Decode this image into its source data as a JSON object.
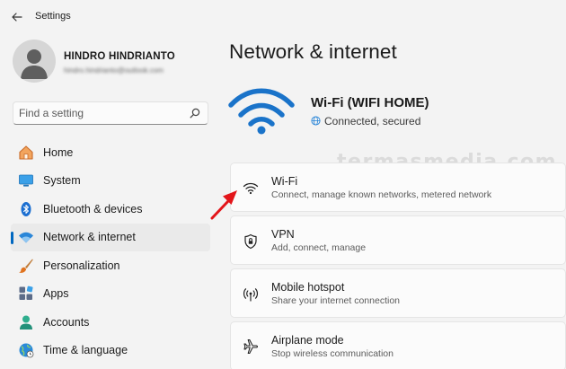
{
  "app": {
    "title": "Settings"
  },
  "profile": {
    "name": "HINDRO HINDRIANTO",
    "email": "hindro.hindrianto@outlook.com"
  },
  "search": {
    "placeholder": "Find a setting"
  },
  "nav": {
    "items": [
      {
        "label": "Home",
        "icon": "home-icon"
      },
      {
        "label": "System",
        "icon": "system-icon"
      },
      {
        "label": "Bluetooth & devices",
        "icon": "bluetooth-icon"
      },
      {
        "label": "Network & internet",
        "icon": "network-icon",
        "active": true
      },
      {
        "label": "Personalization",
        "icon": "brush-icon"
      },
      {
        "label": "Apps",
        "icon": "apps-icon"
      },
      {
        "label": "Accounts",
        "icon": "accounts-icon"
      },
      {
        "label": "Time & language",
        "icon": "globe-icon"
      }
    ]
  },
  "main": {
    "title": "Network & internet",
    "network": {
      "name": "Wi-Fi (WIFI HOME)",
      "status": "Connected, secured"
    },
    "cards": [
      {
        "title": "Wi-Fi",
        "description": "Connect, manage known networks, metered network",
        "icon": "wifi-icon"
      },
      {
        "title": "VPN",
        "description": "Add, connect, manage",
        "icon": "shield-icon"
      },
      {
        "title": "Mobile hotspot",
        "description": "Share your internet connection",
        "icon": "hotspot-icon"
      },
      {
        "title": "Airplane mode",
        "description": "Stop wireless communication",
        "icon": "airplane-icon"
      }
    ]
  },
  "watermark": "termasmedia.com",
  "colors": {
    "accent": "#0067c0",
    "wifi_blue": "#1a73c9",
    "arrow_red": "#e3151a"
  }
}
